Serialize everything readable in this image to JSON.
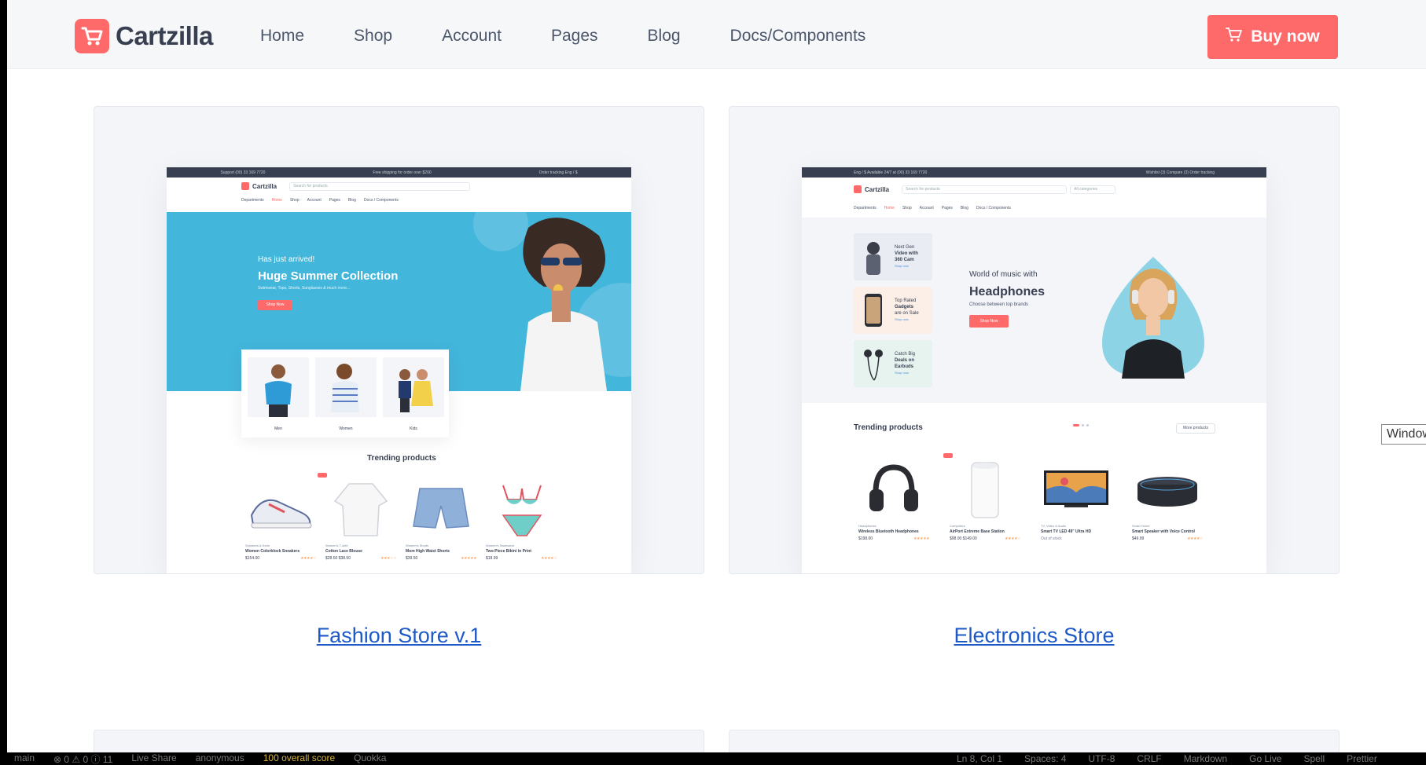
{
  "brand": {
    "name": "Cartzilla",
    "accent": "#fe696a",
    "dark": "#373f50",
    "link": "#1e59c8"
  },
  "nav": {
    "items": [
      "Home",
      "Shop",
      "Account",
      "Pages",
      "Blog",
      "Docs/Components"
    ]
  },
  "buy_button": {
    "label": "Buy now",
    "icon": "cart-icon"
  },
  "demos": [
    {
      "link_label": "Fashion Store v.1",
      "preview": {
        "topbar": {
          "left": "Support (00) 33 169 7720",
          "center": "Free shipping for order over $200",
          "right": "Order tracking   Eng / $"
        },
        "logo": "Cartzilla",
        "search_placeholder": "Search for products",
        "nav": [
          "Departments",
          "Home",
          "Shop",
          "Account",
          "Pages",
          "Blog",
          "Docs / Components"
        ],
        "hero": {
          "subtitle": "Has just arrived!",
          "title": "Huge Summer Collection",
          "description": "Swimwear, Tops, Shorts, Sunglasses & much more...",
          "button": "Shop Now"
        },
        "categories": [
          "Men",
          "Women",
          "Kids"
        ],
        "trending_title": "Trending products",
        "products": [
          {
            "category": "Sneakers & Keds",
            "name": "Women Colorblock Sneakers",
            "price": "$154.00",
            "stars": "★★★★☆"
          },
          {
            "category": "Women's T-shirt",
            "name": "Cotton Lace Blouse",
            "price": "$28.50 $38.50",
            "stars": "★★★☆☆",
            "badge": "Sale"
          },
          {
            "category": "Women's Shorts",
            "name": "Mom High Waist Shorts",
            "price": "$39.50",
            "stars": "★★★★★"
          },
          {
            "category": "Women's Swimwear",
            "name": "Two-Piece Bikini in Print",
            "price": "$18.99",
            "stars": "★★★★☆"
          }
        ]
      }
    },
    {
      "link_label": "Electronics Store",
      "preview": {
        "topbar": {
          "left": "Eng / $   Available 24/7 at (00) 33 169 7720",
          "right": "Wishlist (3)   Compare (3)   Order tracking"
        },
        "logo": "Cartzilla",
        "search_placeholder": "Search for products",
        "categories_select": "All categories",
        "nav": [
          "Departments",
          "Home",
          "Shop",
          "Account",
          "Pages",
          "Blog",
          "Docs / Components"
        ],
        "promos": [
          {
            "lines": [
              "Next Gen",
              "Video with",
              "360 Cam"
            ],
            "link": "Shop now",
            "bg": "#e9ecf3"
          },
          {
            "lines": [
              "Top Rated",
              "Gadgets",
              "are on Sale"
            ],
            "link": "Shop now",
            "bg": "#fcefe7"
          },
          {
            "lines": [
              "Catch Big",
              "Deals on",
              "Earbuds"
            ],
            "link": "Shop now",
            "bg": "#e6f3ef"
          }
        ],
        "hero": {
          "subtitle": "World of music with",
          "title": "Headphones",
          "description": "Choose between top brands",
          "button": "Shop Now"
        },
        "trending_title": "Trending products",
        "more_button": "More products",
        "products": [
          {
            "category": "Headphones",
            "name": "Wireless Bluetooth Headphones",
            "price": "$198.00",
            "stars": "★★★★★"
          },
          {
            "category": "Computers",
            "name": "AirPort Extreme Base Station",
            "price": "$98.00 $149.00",
            "stars": "★★★★☆",
            "badge": "Sale"
          },
          {
            "category": "TV, Video & Audio",
            "name": "Smart TV LED 49\" Ultra HD",
            "price": "Out of stock",
            "stars": ""
          },
          {
            "category": "Smart Home",
            "name": "Smart Speaker with Voice Control",
            "price": "$49.99",
            "stars": "★★★★☆"
          }
        ]
      }
    }
  ],
  "tooltip": "Windows",
  "statusbar": {
    "left": [
      "main",
      "⊗ 0 ⚠ 0 ⓘ 11",
      "Live Share",
      "anonymous",
      "100 overall score",
      "Quokka"
    ],
    "right": [
      "Ln 8, Col 1",
      "Spaces: 4",
      "UTF-8",
      "CRLF",
      "Markdown",
      "Go Live",
      "Spell",
      "Prettier"
    ]
  }
}
